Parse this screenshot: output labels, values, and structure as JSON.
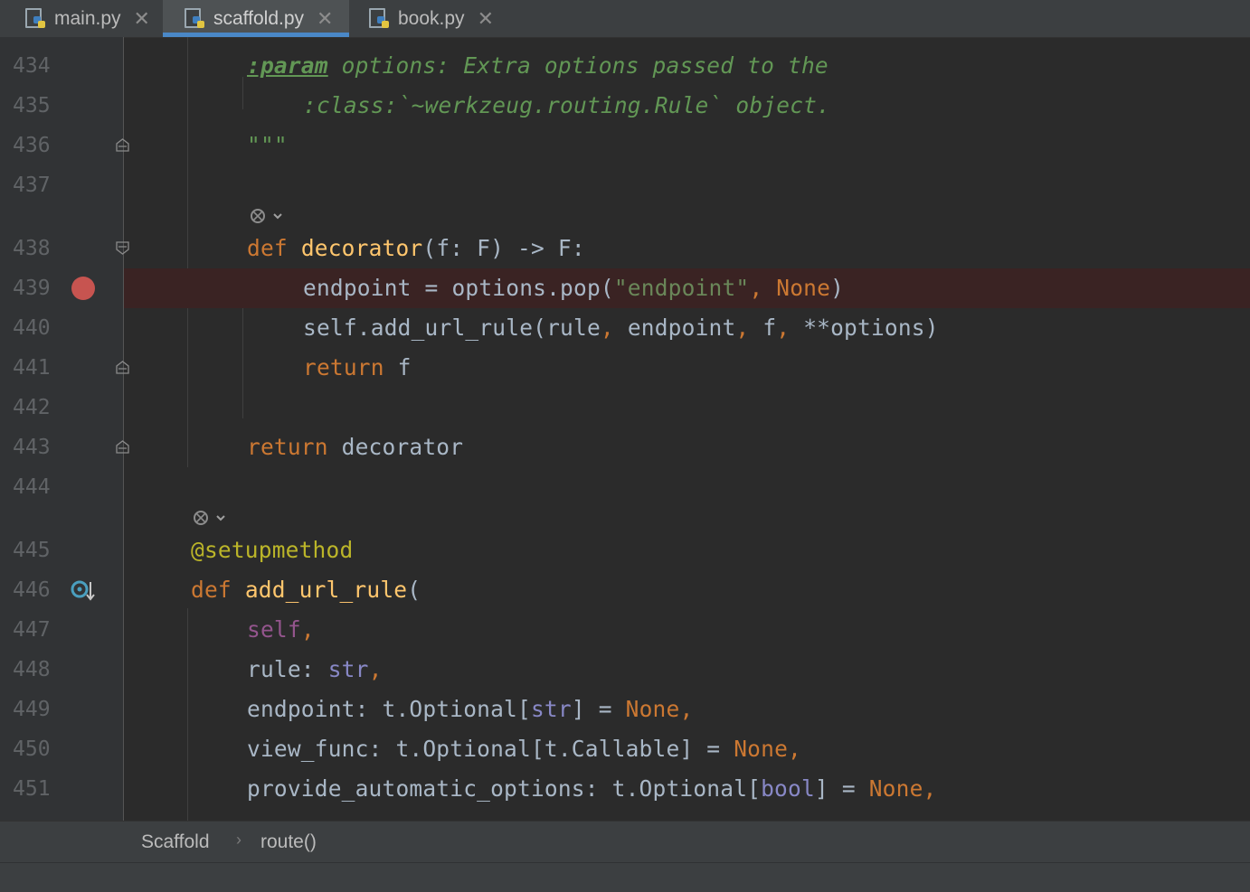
{
  "tabs": [
    {
      "label": "main.py",
      "active": false
    },
    {
      "label": "scaffold.py",
      "active": true
    },
    {
      "label": "book.py",
      "active": false
    }
  ],
  "lines": {
    "l434": "434",
    "l435": "435",
    "l436": "436",
    "l437": "437",
    "l438": "438",
    "l439": "439",
    "l440": "440",
    "l441": "441",
    "l442": "442",
    "l443": "443",
    "l444": "444",
    "l445": "445",
    "l446": "446",
    "l447": "447",
    "l448": "448",
    "l449": "449",
    "l450": "450",
    "l451": "451"
  },
  "code": {
    "c434_tag": ":param",
    "c434_text": " options: Extra options passed to the",
    "c435": ":class:`~werkzeug.routing.Rule` object.",
    "c436": "\"\"\"",
    "c438_def": "def ",
    "c438_name": "decorator",
    "c438_rest": "(f: F) -> F:",
    "c439_a": "endpoint = options.pop(",
    "c439_str": "\"endpoint\"",
    "c439_comma": ", ",
    "c439_none": "None",
    "c439_end": ")",
    "c440_a": "self.add_url_rule(rule",
    "c440_c1": ", ",
    "c440_b": "endpoint",
    "c440_c2": ", ",
    "c440_c": "f",
    "c440_c3": ", ",
    "c440_d": "**options)",
    "c441_kw": "return ",
    "c441_val": "f",
    "c443_kw": "return ",
    "c443_val": "decorator",
    "c445": "@setupmethod",
    "c446_def": "def ",
    "c446_name": "add_url_rule",
    "c446_paren": "(",
    "c447_self": "self",
    "c447_comma": ",",
    "c448_a": "rule: ",
    "c448_type": "str",
    "c448_comma": ",",
    "c449_a": "endpoint: t.Optional[",
    "c449_type": "str",
    "c449_b": "] = ",
    "c449_none": "None",
    "c449_comma": ",",
    "c450_a": "view_func: t.Optional[t.Callable] = ",
    "c450_none": "None",
    "c450_comma": ",",
    "c451_a": "provide_automatic_options: t.Optional[",
    "c451_type": "bool",
    "c451_b": "] = ",
    "c451_none": "None",
    "c451_comma": ","
  },
  "breadcrumb": {
    "items": [
      "Scaffold",
      "route()"
    ],
    "separator": "›"
  },
  "colors": {
    "keyword": "#cc7832",
    "function": "#ffc66d",
    "string": "#6a8759",
    "docstring": "#629755",
    "breakpoint": "#c75450",
    "accent": "#4a88c7"
  }
}
